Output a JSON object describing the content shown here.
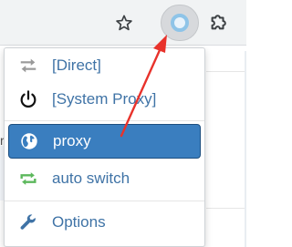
{
  "toolbar": {
    "bookmark_icon": "star-icon",
    "extension_icon": "proxy-ring-icon",
    "extensions_menu_icon": "puzzle-icon"
  },
  "page": {
    "snippet": "rg"
  },
  "menu": {
    "items": [
      {
        "label": "[Direct]",
        "icon": "direct-arrows-icon",
        "active": false
      },
      {
        "label": "[System Proxy]",
        "icon": "power-icon",
        "active": false
      },
      {
        "label": "proxy",
        "icon": "globe-icon",
        "active": true
      },
      {
        "label": "auto switch",
        "icon": "repeat-icon",
        "active": false
      },
      {
        "label": "Options",
        "icon": "wrench-icon",
        "active": false
      }
    ]
  },
  "colors": {
    "link": "#3f73a6",
    "active_bg": "#3a7ebf",
    "annotation": "#e8322b"
  }
}
